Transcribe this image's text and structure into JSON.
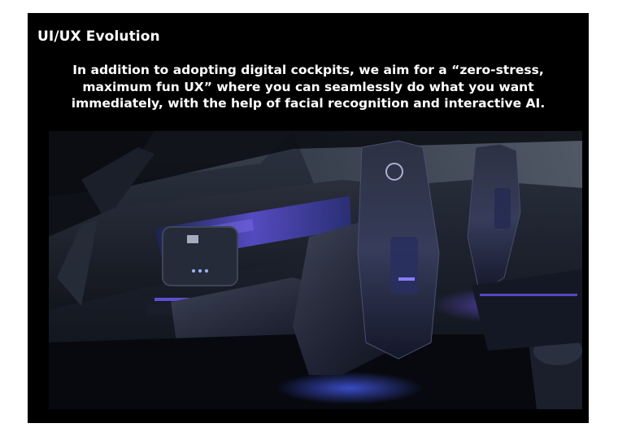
{
  "slide": {
    "title": "UI/UX Evolution",
    "lead": "In addition to adopting digital cockpits, we aim for a “zero-stress, maximum fun UX” where you can seamlessly do what you want immediately, with the help of facial recognition and interactive AI."
  },
  "colors": {
    "background": "#000000",
    "text": "#ffffff",
    "accent_glow": "#6f5cff"
  }
}
